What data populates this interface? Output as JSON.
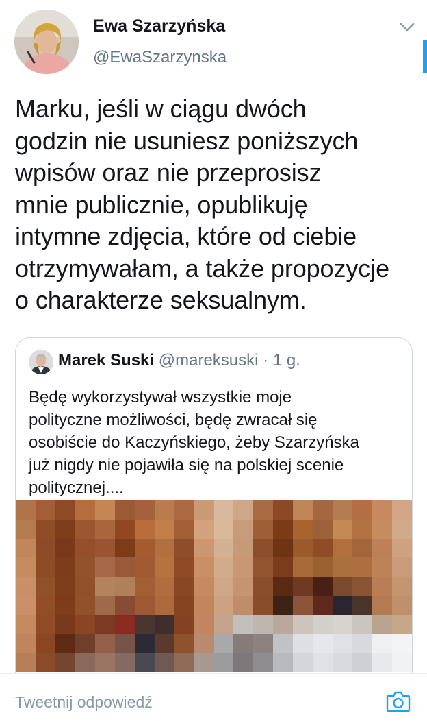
{
  "tweet": {
    "author_name": "Ewa Szarzyńska",
    "author_handle": "@EwaSzarzynska",
    "text_lines": [
      "Marku, jeśli w ciągu dwóch",
      "godzin nie usuniesz poniższych",
      "wpisów oraz nie przeprosisz",
      "mnie publicznie, opublikuję",
      "intymne zdjęcia, które od ciebie",
      "otrzymywałam, a także propozycje",
      "o charakterze seksualnym."
    ]
  },
  "quoted_tweet": {
    "author_name": "Marek Suski",
    "author_handle": "@mareksuski",
    "separator": "·",
    "time": "1 g.",
    "text_lines": [
      "Będę wykorzystywał wszystkie moje",
      "polityczne możliwości, będę zwracał się",
      "osobiście do Kaczyńskiego, żeby Szarzyńska",
      "już nigdy nie pojawiła się na polskiej scenie",
      "politycznej...."
    ],
    "media": {
      "description_icon": "pixelated-image",
      "grid_cols": 20,
      "grid_rows": 9,
      "palette": [
        "#b0734a",
        "#a35e35",
        "#8e4a24",
        "#b46d3c",
        "#c48655",
        "#9a5a34",
        "#a4613a",
        "#ba7b4d",
        "#ad6a40",
        "#c99a74",
        "#d8b79b",
        "#cfa788",
        "#a86b42",
        "#8b4a25",
        "#c18656",
        "#a5673f",
        "#b57d4f",
        "#b36f42",
        "#c78a5e",
        "#d2a684",
        "#b57b50",
        "#8f4c26",
        "#7f3d1a",
        "#9c5630",
        "#a9653b",
        "#8f4820",
        "#b76d3c",
        "#c27d48",
        "#a15e37",
        "#d3a27d",
        "#d9b89a",
        "#c89c7a",
        "#9e5e36",
        "#7b3b17",
        "#a8642f",
        "#9b6238",
        "#c48a55",
        "#b27242",
        "#c78b60",
        "#d3aa88",
        "#c1865a",
        "#8e4b27",
        "#7a3918",
        "#954f2a",
        "#9a5530",
        "#7e3b18",
        "#a45b2f",
        "#b2703f",
        "#8f4d2a",
        "#cb9670",
        "#d3b092",
        "#c69a77",
        "#8d4f2b",
        "#6f3412",
        "#9a5a2a",
        "#8e4d24",
        "#b06f3c",
        "#a5653b",
        "#bd8057",
        "#cea17f",
        "#c58c5f",
        "#8d4b26",
        "#7d3c1a",
        "#94522c",
        "#a7684a",
        "#9a5a3a",
        "#a25a32",
        "#b6733f",
        "#8e4a25",
        "#c98f66",
        "#d1ab8a",
        "#c79873",
        "#92552f",
        "#7a3c1a",
        "#a76a38",
        "#9a6231",
        "#a8713e",
        "#ae6e3f",
        "#be8257",
        "#c99b78",
        "#c89066",
        "#915128",
        "#7f3e1b",
        "#925029",
        "#b3835e",
        "#b08058",
        "#a35e36",
        "#b16d3d",
        "#8a4724",
        "#c58a60",
        "#cfa686",
        "#c59471",
        "#8b4e2a",
        "#5a2a12",
        "#6e3a22",
        "#4a2016",
        "#7b4a2d",
        "#8b5535",
        "#b87e55",
        "#c59570",
        "#c99169",
        "#924f27",
        "#7e3c1a",
        "#93512b",
        "#9e6a4b",
        "#8a4b34",
        "#9e5832",
        "#ad6a3a",
        "#874422",
        "#c2865c",
        "#cca283",
        "#bf8d69",
        "#8a4d2a",
        "#3d2216",
        "#8c5438",
        "#5e2a1e",
        "#2a2630",
        "#4b352a",
        "#b47b53",
        "#c0906c",
        "#c48b61",
        "#8f4c25",
        "#7a391a",
        "#8a4623",
        "#7a3a24",
        "#8a2b1f",
        "#4a3531",
        "#3f2f2c",
        "#844222",
        "#c18660",
        "#c4a28c",
        "#c3c0bb",
        "#bfb7ae",
        "#b8a99c",
        "#cdc5bd",
        "#d3d0cb",
        "#d7d4d0",
        "#cbc5bf",
        "#b9a58f",
        "#c5a789",
        "#bf855c",
        "#8b4722",
        "#5f2a13",
        "#6f3f2b",
        "#94604a",
        "#765448",
        "#2a2b35",
        "#5a3a2c",
        "#8e532d",
        "#b98a6d",
        "#a8a9ab",
        "#857c77",
        "#8a8380",
        "#c0c2c6",
        "#dedfe2",
        "#e6e7ea",
        "#e0e1e5",
        "#d8d9dc",
        "#eef0f2",
        "#f3f4f6",
        "#b77f57",
        "#8c4b28",
        "#75452f",
        "#8a6a58",
        "#9b7563",
        "#846a60",
        "#4a4850",
        "#6e5a51",
        "#8f6a55",
        "#a7998f",
        "#9b9a9c",
        "#7d797a",
        "#8f8d8f",
        "#b8b9bc",
        "#d5d6da",
        "#e0e1e5",
        "#d9dadd",
        "#cfd0d3",
        "#e8e9ec",
        "#f1f2f4"
      ]
    }
  },
  "reply_bar": {
    "placeholder": "Tweetnij odpowiedź"
  },
  "colors": {
    "accent": "#1da1f2",
    "secondary_text": "#657786",
    "border": "#ccd6dd"
  },
  "icons": {
    "menu": "chevron-down-icon",
    "camera": "camera-icon"
  }
}
